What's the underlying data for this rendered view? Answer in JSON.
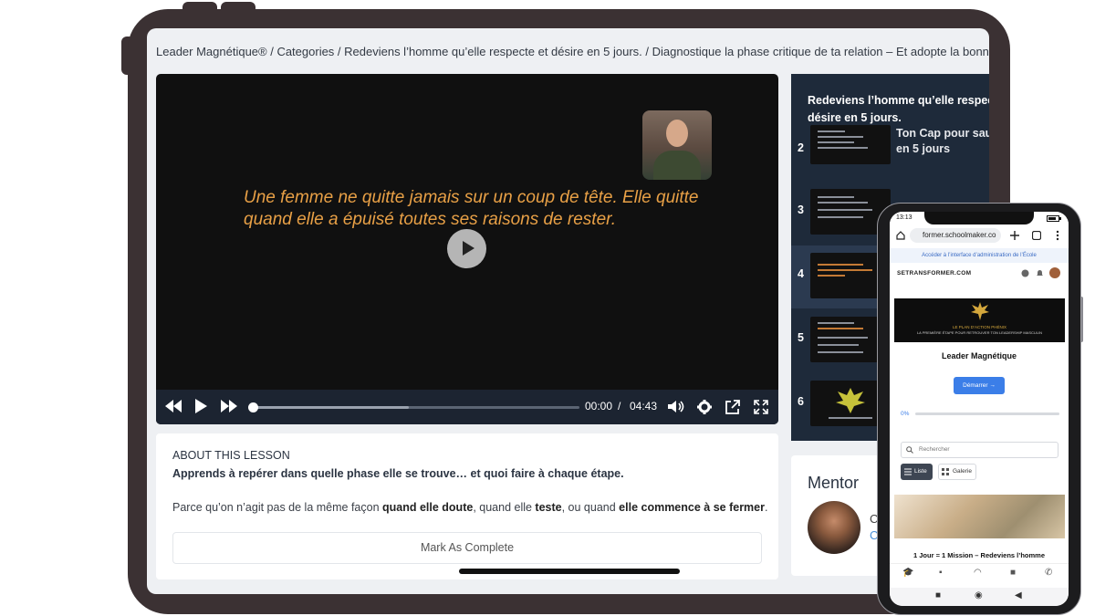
{
  "tablet": {
    "breadcrumb": "Leader Magnétique® / Categories / Redeviens l’homme qu’elle respecte et désire en 5 jours. / Diagnostique la phase critique de ta relation – Et adopte la bonne stra",
    "video": {
      "quote": "Une femme ne quitte jamais sur un coup de tête. Elle quitte quand elle a épuisé toutes ses raisons de rester.",
      "current_time": "00:00",
      "separator": "/",
      "duration": "04:43",
      "progress": 0,
      "icons": [
        "rewind-icon",
        "play-icon",
        "fast-forward-icon",
        "volume-icon",
        "gear-icon",
        "external-link-icon",
        "fullscreen-icon"
      ]
    },
    "lesson": {
      "heading": "ABOUT THIS LESSON",
      "subtitle": "Apprends à repérer dans quelle phase elle se trouve… et quoi faire à chaque étape.",
      "desc_1": "Parce qu’on n’agit pas de la même façon ",
      "desc_b1": "quand elle doute",
      "desc_2": ", quand elle ",
      "desc_b2": "teste",
      "desc_3": ", ou quand ",
      "desc_b3": "elle commence à se fermer",
      "desc_4": ".",
      "mark_complete": "Mark As Complete"
    },
    "sidebar": {
      "title_line1": "Redeviens l’homme qu’elle respecte",
      "title_line2": "désire en 5 jours.",
      "items": [
        {
          "num": "2",
          "line1": "Ton Cap pour sauv",
          "line2": "en 5 jours"
        },
        {
          "num": "3",
          "line1": "",
          "line2": ""
        },
        {
          "num": "4",
          "line1": "",
          "line2": ""
        },
        {
          "num": "5",
          "line1": "",
          "line2": ""
        },
        {
          "num": "6",
          "line1": "",
          "line2": ""
        }
      ]
    },
    "mentor": {
      "title": "Mentor",
      "initial": "C",
      "initial_link": "C"
    }
  },
  "phone": {
    "status_time": "13:13",
    "url": "former.schoolmaker.co",
    "admin_bar": "Accéder à l’interface d’administration de l’École",
    "brand": "SETRANSFORMER.COM",
    "banner_title": "LE PLAN D’ACTION PHÉNIX",
    "banner_sub": "LA PREMIÈRE ÉTAPE POUR RETROUVER TON LEADERSHIP MASCULIN",
    "course_title": "Leader Magnétique",
    "start_button": "Démarrer →",
    "progress_label": "0%",
    "search_placeholder": "Rechercher",
    "tab_list": "Liste",
    "tab_gallery": "Galerie",
    "lesson_title": "1 Jour = 1 Mission – Redeviens l’homme"
  },
  "colors": {
    "device_frame": "#3b3133",
    "sidebar_bg": "#1e2a3a",
    "quote_text": "#e8a046",
    "accent_blue": "#3b7ee8"
  }
}
